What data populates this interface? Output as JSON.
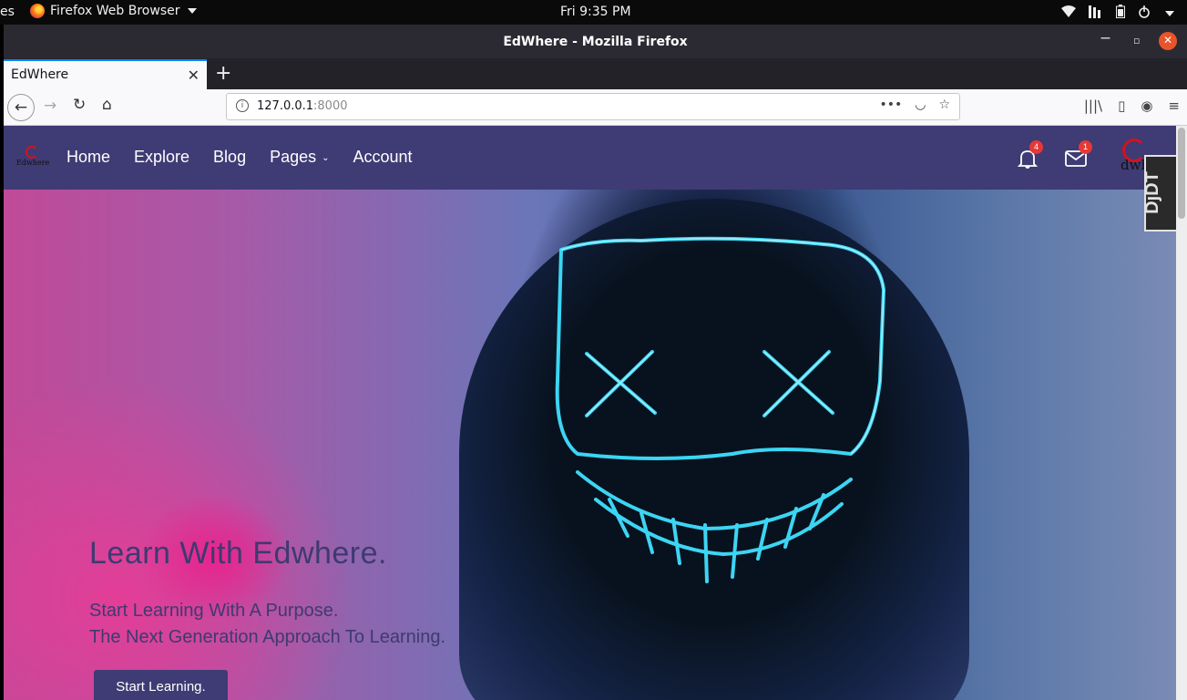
{
  "os": {
    "activities": "es",
    "app_menu": "Firefox Web Browser",
    "clock": "Fri  9:35 PM"
  },
  "browser": {
    "window_title": "EdWhere - Mozilla Firefox",
    "tab_title": "EdWhere",
    "url_host": "127.0.0.1",
    "url_port": ":8000"
  },
  "site": {
    "brand_small": "Edwhere",
    "nav": {
      "home": "Home",
      "explore": "Explore",
      "blog": "Blog",
      "pages": "Pages",
      "account": "Account"
    },
    "notifications_count": "4",
    "messages_count": "1",
    "account_logo_text": "dwhe",
    "debug_toolbar": "DjDT"
  },
  "hero": {
    "title": "Learn With Edwhere.",
    "subtitle_line1": "Start Learning With A Purpose.",
    "subtitle_line2": "The Next Generation Approach To Learning.",
    "cta": "Start Learning."
  },
  "colors": {
    "nav_bg": "#3f3b74",
    "hero_text": "#3e3a70",
    "badge": "#e53935",
    "mask_glow": "#3fe0ff"
  }
}
